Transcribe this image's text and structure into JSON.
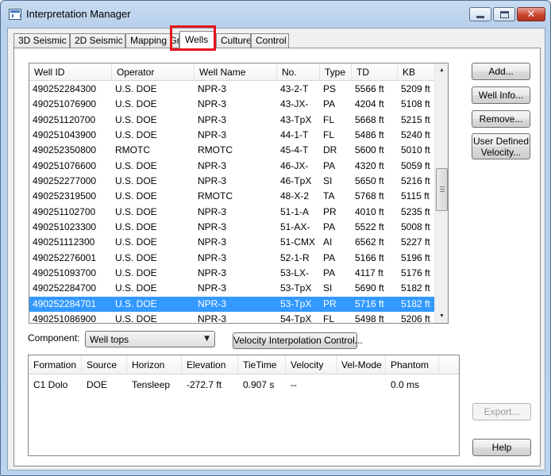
{
  "window": {
    "title": "Interpretation Manager",
    "icon": "app-icon"
  },
  "tabs": [
    {
      "label": "3D Seismic"
    },
    {
      "label": "2D Seismic"
    },
    {
      "label": "Mapping Gri"
    },
    {
      "label": "Wells",
      "active": true
    },
    {
      "label": "Culture"
    },
    {
      "label": "Control"
    }
  ],
  "wells_table": {
    "columns": [
      "Well ID",
      "Operator",
      "Well Name",
      "No.",
      "Type",
      "TD",
      "KB"
    ],
    "rows": [
      [
        "490252284300",
        "U.S. DOE",
        "NPR-3",
        "43-2-T",
        "PS",
        "5566 ft",
        "5209 ft"
      ],
      [
        "490251076900",
        "U.S. DOE",
        "NPR-3",
        "43-JX-",
        "PA",
        "4204 ft",
        "5108 ft"
      ],
      [
        "490251120700",
        "U.S. DOE",
        "NPR-3",
        "43-TpX",
        "FL",
        "5668 ft",
        "5215 ft"
      ],
      [
        "490251043900",
        "U.S. DOE",
        "NPR-3",
        "44-1-T",
        "FL",
        "5486 ft",
        "5240 ft"
      ],
      [
        "490252350800",
        "RMOTC",
        "RMOTC",
        "45-4-T",
        "DR",
        "5600 ft",
        "5010 ft"
      ],
      [
        "490251076600",
        "U.S. DOE",
        "NPR-3",
        "46-JX-",
        "PA",
        "4320 ft",
        "5059 ft"
      ],
      [
        "490252277000",
        "U.S. DOE",
        "NPR-3",
        "46-TpX",
        "SI",
        "5650 ft",
        "5216 ft"
      ],
      [
        "490252319500",
        "U.S. DOE",
        "RMOTC",
        "48-X-2",
        "TA",
        "5768 ft",
        "5115 ft"
      ],
      [
        "490251102700",
        "U.S. DOE",
        "NPR-3",
        "51-1-A",
        "PR",
        "4010 ft",
        "5235 ft"
      ],
      [
        "490251023300",
        "U.S. DOE",
        "NPR-3",
        "51-AX-",
        "PA",
        "5522 ft",
        "5008 ft"
      ],
      [
        "490251112300",
        "U.S. DOE",
        "NPR-3",
        "51-CMX",
        "AI",
        "6562 ft",
        "5227 ft"
      ],
      [
        "490252276001",
        "U.S. DOE",
        "NPR-3",
        "52-1-R",
        "PA",
        "5166 ft",
        "5196 ft"
      ],
      [
        "490251093700",
        "U.S. DOE",
        "NPR-3",
        "53-LX-",
        "PA",
        "4117 ft",
        "5176 ft"
      ],
      [
        "490252284700",
        "U.S. DOE",
        "NPR-3",
        "53-TpX",
        "SI",
        "5690 ft",
        "5182 ft"
      ],
      [
        "490252284701",
        "U.S. DOE",
        "NPR-3",
        "53-TpX",
        "PR",
        "5716 ft",
        "5182 ft"
      ],
      [
        "490251086900",
        "U.S. DOE",
        "NPR-3",
        "54-TpX",
        "FL",
        "5498 ft",
        "5206 ft"
      ]
    ],
    "selected_index": 14
  },
  "side_buttons": {
    "add": "Add...",
    "well_info": "Well Info...",
    "remove": "Remove...",
    "user_defined_velocity": "User Defined Velocity..."
  },
  "component": {
    "label": "Component:",
    "value": "Well tops"
  },
  "velocity_button": "Velocity Interpolation Control...",
  "tops_table": {
    "columns": [
      "Formation",
      "Source",
      "Horizon",
      "Elevation",
      "TieTime",
      "Velocity",
      "Vel-Mode",
      "Phantom"
    ],
    "rows": [
      [
        "C1 Dolo",
        "DOE",
        "Tensleep",
        "-272.7 ft",
        "0.907 s",
        "--",
        "",
        "0.0 ms"
      ]
    ]
  },
  "export_button": "Export...",
  "help_button": "Help",
  "colors": {
    "selection": "#3399ff",
    "tab_highlight": "#e8141b"
  }
}
